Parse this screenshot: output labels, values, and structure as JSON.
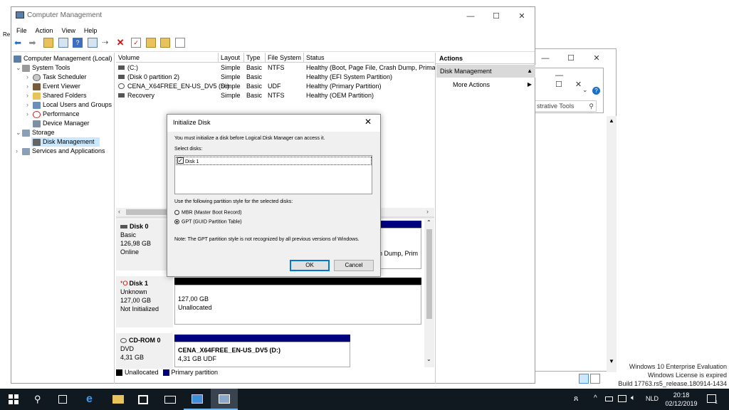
{
  "window": {
    "title": "Computer Management",
    "controls": [
      "—",
      "☐",
      "✕"
    ],
    "menu": [
      "File",
      "Action",
      "View",
      "Help"
    ]
  },
  "tree": {
    "items": [
      {
        "label": "Computer Management (Local)",
        "icon": "computer-management-icon"
      },
      {
        "label": "System Tools",
        "icon": "system-tools-icon"
      },
      {
        "label": "Task Scheduler",
        "icon": "task-scheduler-icon"
      },
      {
        "label": "Event Viewer",
        "icon": "event-viewer-icon"
      },
      {
        "label": "Shared Folders",
        "icon": "shared-folders-icon"
      },
      {
        "label": "Local Users and Groups",
        "icon": "users-icon"
      },
      {
        "label": "Performance",
        "icon": "performance-icon"
      },
      {
        "label": "Device Manager",
        "icon": "device-manager-icon"
      },
      {
        "label": "Storage",
        "icon": "storage-icon"
      },
      {
        "label": "Disk Management",
        "icon": "disk-management-icon"
      },
      {
        "label": "Services and Applications",
        "icon": "services-icon"
      }
    ]
  },
  "volumes": {
    "columns": [
      "Volume",
      "Layout",
      "Type",
      "File System",
      "Status"
    ],
    "rows": [
      {
        "volume": "(C:)",
        "layout": "Simple",
        "type": "Basic",
        "fs": "NTFS",
        "status": "Healthy (Boot, Page File, Crash Dump, Prima"
      },
      {
        "volume": "(Disk 0 partition 2)",
        "layout": "Simple",
        "type": "Basic",
        "fs": "",
        "status": "Healthy (EFI System Partition)"
      },
      {
        "volume": "CENA_X64FREE_EN-US_DV5 (D:)",
        "layout": "Simple",
        "type": "Basic",
        "fs": "UDF",
        "status": "Healthy (Primary Partition)"
      },
      {
        "volume": "Recovery",
        "layout": "Simple",
        "type": "Basic",
        "fs": "NTFS",
        "status": "Healthy (OEM Partition)"
      }
    ]
  },
  "disks": {
    "disk0": {
      "name": "Disk 0",
      "type": "Basic",
      "size": "126,98 GB",
      "status": "Online",
      "partial_status": "n Dump, Prim"
    },
    "disk1": {
      "name": "Disk 1",
      "type": "Unknown",
      "size": "127,00 GB",
      "status": "Not Initialized",
      "part_size": "127,00 GB",
      "part_status": "Unallocated"
    },
    "cdrom": {
      "name": "CD-ROM 0",
      "type": "DVD",
      "size": "4,31 GB",
      "part_name": "CENA_X64FREE_EN-US_DV5 (D:)",
      "part_size": "4,31 GB UDF"
    },
    "legend": [
      "Unallocated",
      "Primary partition"
    ]
  },
  "actions": {
    "header": "Actions",
    "section": "Disk Management",
    "more": "More Actions"
  },
  "dialog": {
    "title": "Initialize Disk",
    "intro": "You must initialize a disk before Logical Disk Manager can access it.",
    "select_label": "Select disks:",
    "disk_item": "Disk 1",
    "partition_label": "Use the following partition style for the selected disks:",
    "mbr": "MBR (Master Boot Record)",
    "gpt": "GPT (GUID Partition Table)",
    "note": "Note: The GPT partition style is not recognized by all previous versions of Windows.",
    "ok": "OK",
    "cancel": "Cancel"
  },
  "background_window": {
    "search_text": "strative Tools"
  },
  "desktop": {
    "edge_label": "Re",
    "watermark": [
      "Windows 10 Enterprise Evaluation",
      "Windows License is expired",
      "Build 17763.rs5_release.180914-1434"
    ]
  },
  "taskbar": {
    "lang": "NLD",
    "time": "20:18",
    "date": "02/12/2019",
    "notification_count": "1"
  },
  "colors": {
    "primary_partition": "#00007f",
    "unallocated": "#000000",
    "selection": "#cce8ff",
    "taskbar": "#101820",
    "action_header": "#d9d9d9"
  }
}
